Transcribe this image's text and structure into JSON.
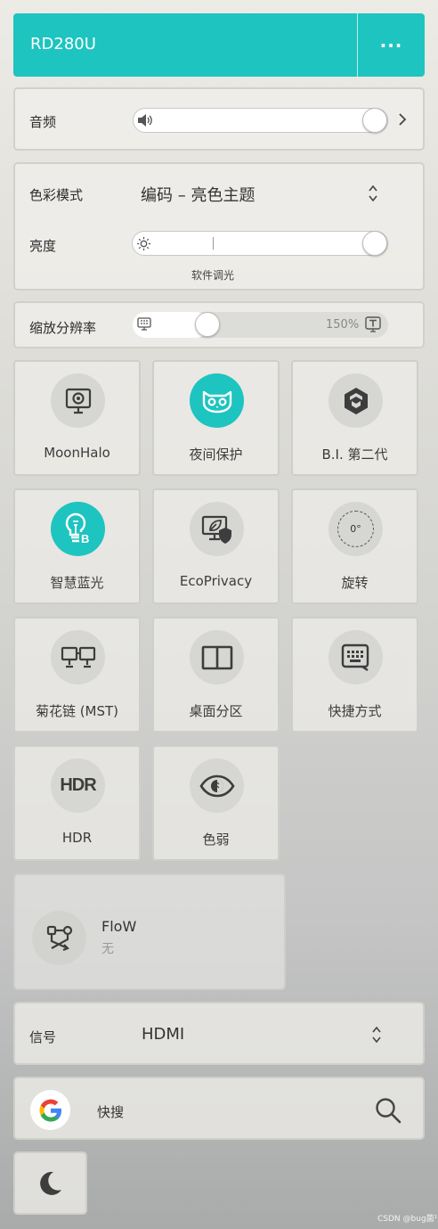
{
  "header": {
    "title": "RD280U",
    "more_label": "···"
  },
  "audio": {
    "label": "音频"
  },
  "color": {
    "mode_label": "色彩模式",
    "mode_value": "编码 – 亮色主题",
    "brightness_label": "亮度",
    "brightness_note": "软件调光"
  },
  "scale": {
    "label": "缩放分辨率",
    "value": "150%"
  },
  "tiles": [
    {
      "label": "MoonHalo",
      "icon": "moonhalo-icon",
      "active": false
    },
    {
      "label": "夜间保护",
      "icon": "owl-icon",
      "active": true
    },
    {
      "label": "B.I. 第二代",
      "icon": "bi-icon",
      "active": false
    },
    {
      "label": "智慧蓝光",
      "icon": "bulb-icon",
      "active": true
    },
    {
      "label": "EcoPrivacy",
      "icon": "eco-icon",
      "active": false
    },
    {
      "label": "旋转",
      "icon": "rotate-icon",
      "active": false,
      "badge": "0°"
    },
    {
      "label": "菊花链 (MST)",
      "icon": "daisy-chain-icon",
      "active": false
    },
    {
      "label": "桌面分区",
      "icon": "partition-icon",
      "active": false
    },
    {
      "label": "快捷方式",
      "icon": "shortcut-icon",
      "active": false
    },
    {
      "label": "HDR",
      "icon": "hdr-icon",
      "active": false,
      "badge": "HDR"
    },
    {
      "label": "色弱",
      "icon": "eye-icon",
      "active": false
    }
  ],
  "flow": {
    "title": "FloW",
    "value": "无"
  },
  "signal": {
    "label": "信号",
    "value": "HDMI"
  },
  "search": {
    "label": "快搜"
  },
  "watermark": "CSDN @bug菌¹",
  "colors": {
    "accent": "#1ec4bf"
  }
}
